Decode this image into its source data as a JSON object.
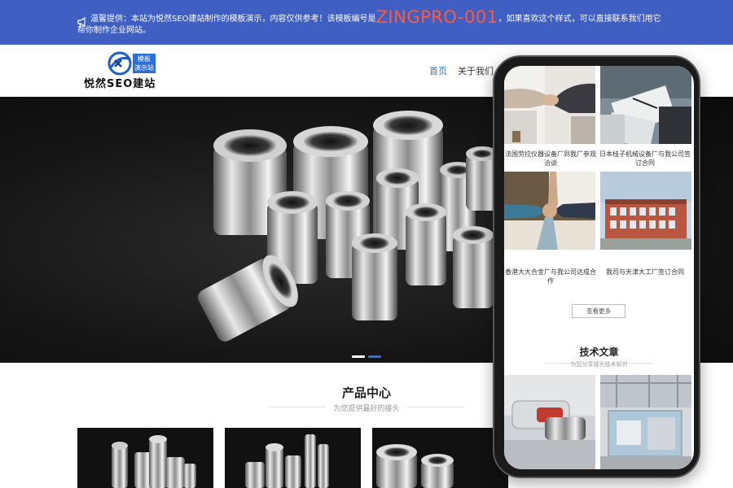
{
  "notice": {
    "text_before": "温馨提供：本站为悦然SEO建站制作的模板演示，内容仅供参考！该模板编号是",
    "code": "ZINGPRO-001",
    "text_after": "，如果喜欢这个样式，可以直接联系我们用它帮你制作企业网站。"
  },
  "logo": {
    "badge_line1": "模板",
    "badge_line2": "演示站",
    "name": "悦然SEO建站"
  },
  "nav": {
    "home": "首页",
    "about": "关于我们"
  },
  "hero": {
    "slides": 2,
    "active_slide": 2
  },
  "products": {
    "title": "产品中心",
    "subtitle": "为您提供最好的接头"
  },
  "phone": {
    "cases": [
      {
        "caption": "法国劳拉仪器设备厂到我厂参观洽谈"
      },
      {
        "caption": "日本桂子机械设备厂与我公司签订合同"
      },
      {
        "caption": "香港大大合金厂与我公司达成合作"
      },
      {
        "caption": "我司与天津大工厂签订合同"
      }
    ],
    "more_label": "查看更多",
    "articles_title": "技术文章",
    "articles_subtitle": "为您分享接头技术知识"
  },
  "colors": {
    "notice_bar": "#3f5fc3",
    "accent": "#2d6fd6",
    "notice_code": "#ff5a3c"
  }
}
